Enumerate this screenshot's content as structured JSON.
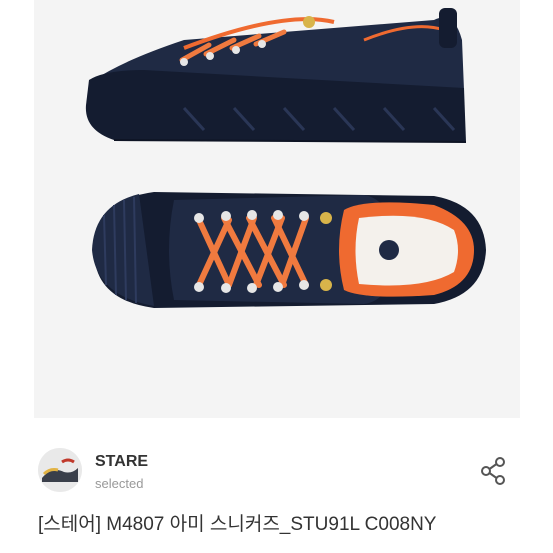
{
  "product": {
    "image_alt": "navy sneakers with orange laces",
    "brand": {
      "name": "STARE",
      "status": "selected"
    },
    "title": "[스테어] M4807 아미 스니커즈_STU91L C008NY",
    "share_icon": "share-icon"
  },
  "colors": {
    "shoe_navy": "#1f2a44",
    "shoe_dark": "#141c30",
    "lace_orange": "#f07a3f",
    "lining_orange": "#ef6a30",
    "background": "#f4f4f4"
  }
}
